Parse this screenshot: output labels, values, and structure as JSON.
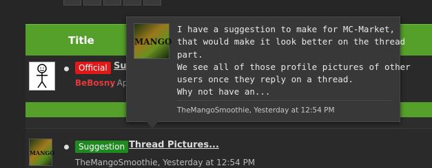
{
  "list": {
    "header": {
      "title_column": "Title"
    },
    "threads": [
      {
        "prefix": "Official",
        "title": "Su",
        "author": "BeBosny",
        "date": "Ap"
      },
      {
        "prefix": "Suggestion",
        "title": "Thread Pictures...",
        "author_line": "TheMangoSmoothie, Yesterday at 12:54 PM"
      }
    ]
  },
  "tooltip": {
    "avatar_text": "MANGO",
    "preview_lines": [
      "I have a suggestion to make for MC-Market,",
      "that would make it look better on the thread",
      "part.",
      "We see all of those profile pictures of other",
      "users once they reply on a thread.",
      "Why not have an..."
    ],
    "meta": "TheMangoSmoothie, Yesterday at 12:54 PM"
  },
  "colors": {
    "accent_green": "#55a02a",
    "official_red": "#e01818",
    "suggestion_green": "#1e8a20"
  }
}
